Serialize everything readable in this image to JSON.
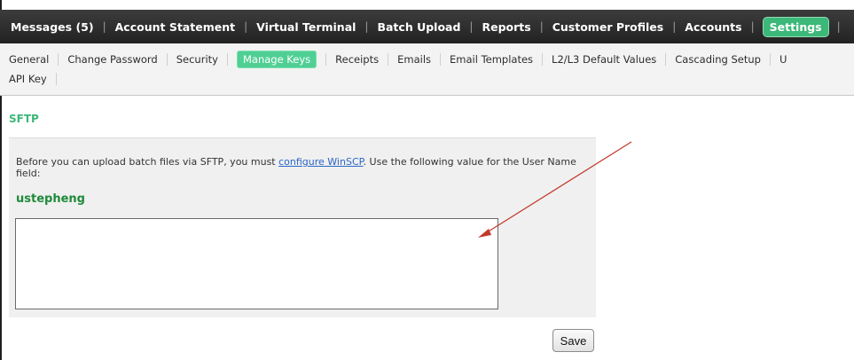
{
  "topnav": {
    "items": [
      {
        "label": "Messages (5)"
      },
      {
        "label": "Account Statement"
      },
      {
        "label": "Virtual Terminal"
      },
      {
        "label": "Batch Upload"
      },
      {
        "label": "Reports"
      },
      {
        "label": "Customer Profiles"
      },
      {
        "label": "Accounts"
      },
      {
        "label": "Settings",
        "active": true
      }
    ]
  },
  "subnav": {
    "items": [
      {
        "label": "General"
      },
      {
        "label": "Change Password"
      },
      {
        "label": "Security"
      },
      {
        "label": "Manage Keys",
        "active": true
      },
      {
        "label": "Receipts"
      },
      {
        "label": "Emails"
      },
      {
        "label": "Email Templates"
      },
      {
        "label": "L2/L3 Default Values"
      },
      {
        "label": "Cascading Setup"
      },
      {
        "label": "U"
      },
      {
        "label": "API Key"
      }
    ]
  },
  "section": {
    "title": "SFTP",
    "intro_before": "Before you can upload batch files via SFTP, you must ",
    "intro_link": "configure WinSCP",
    "intro_after": ". Use the following value for the User Name field:",
    "username": "ustepheng",
    "key_value": ""
  },
  "actions": {
    "save_label": "Save"
  },
  "colors": {
    "accent": "#3cb879",
    "username": "#1f8a3a",
    "link": "#2a66c7",
    "annotation_arrow": "#c0392b"
  }
}
